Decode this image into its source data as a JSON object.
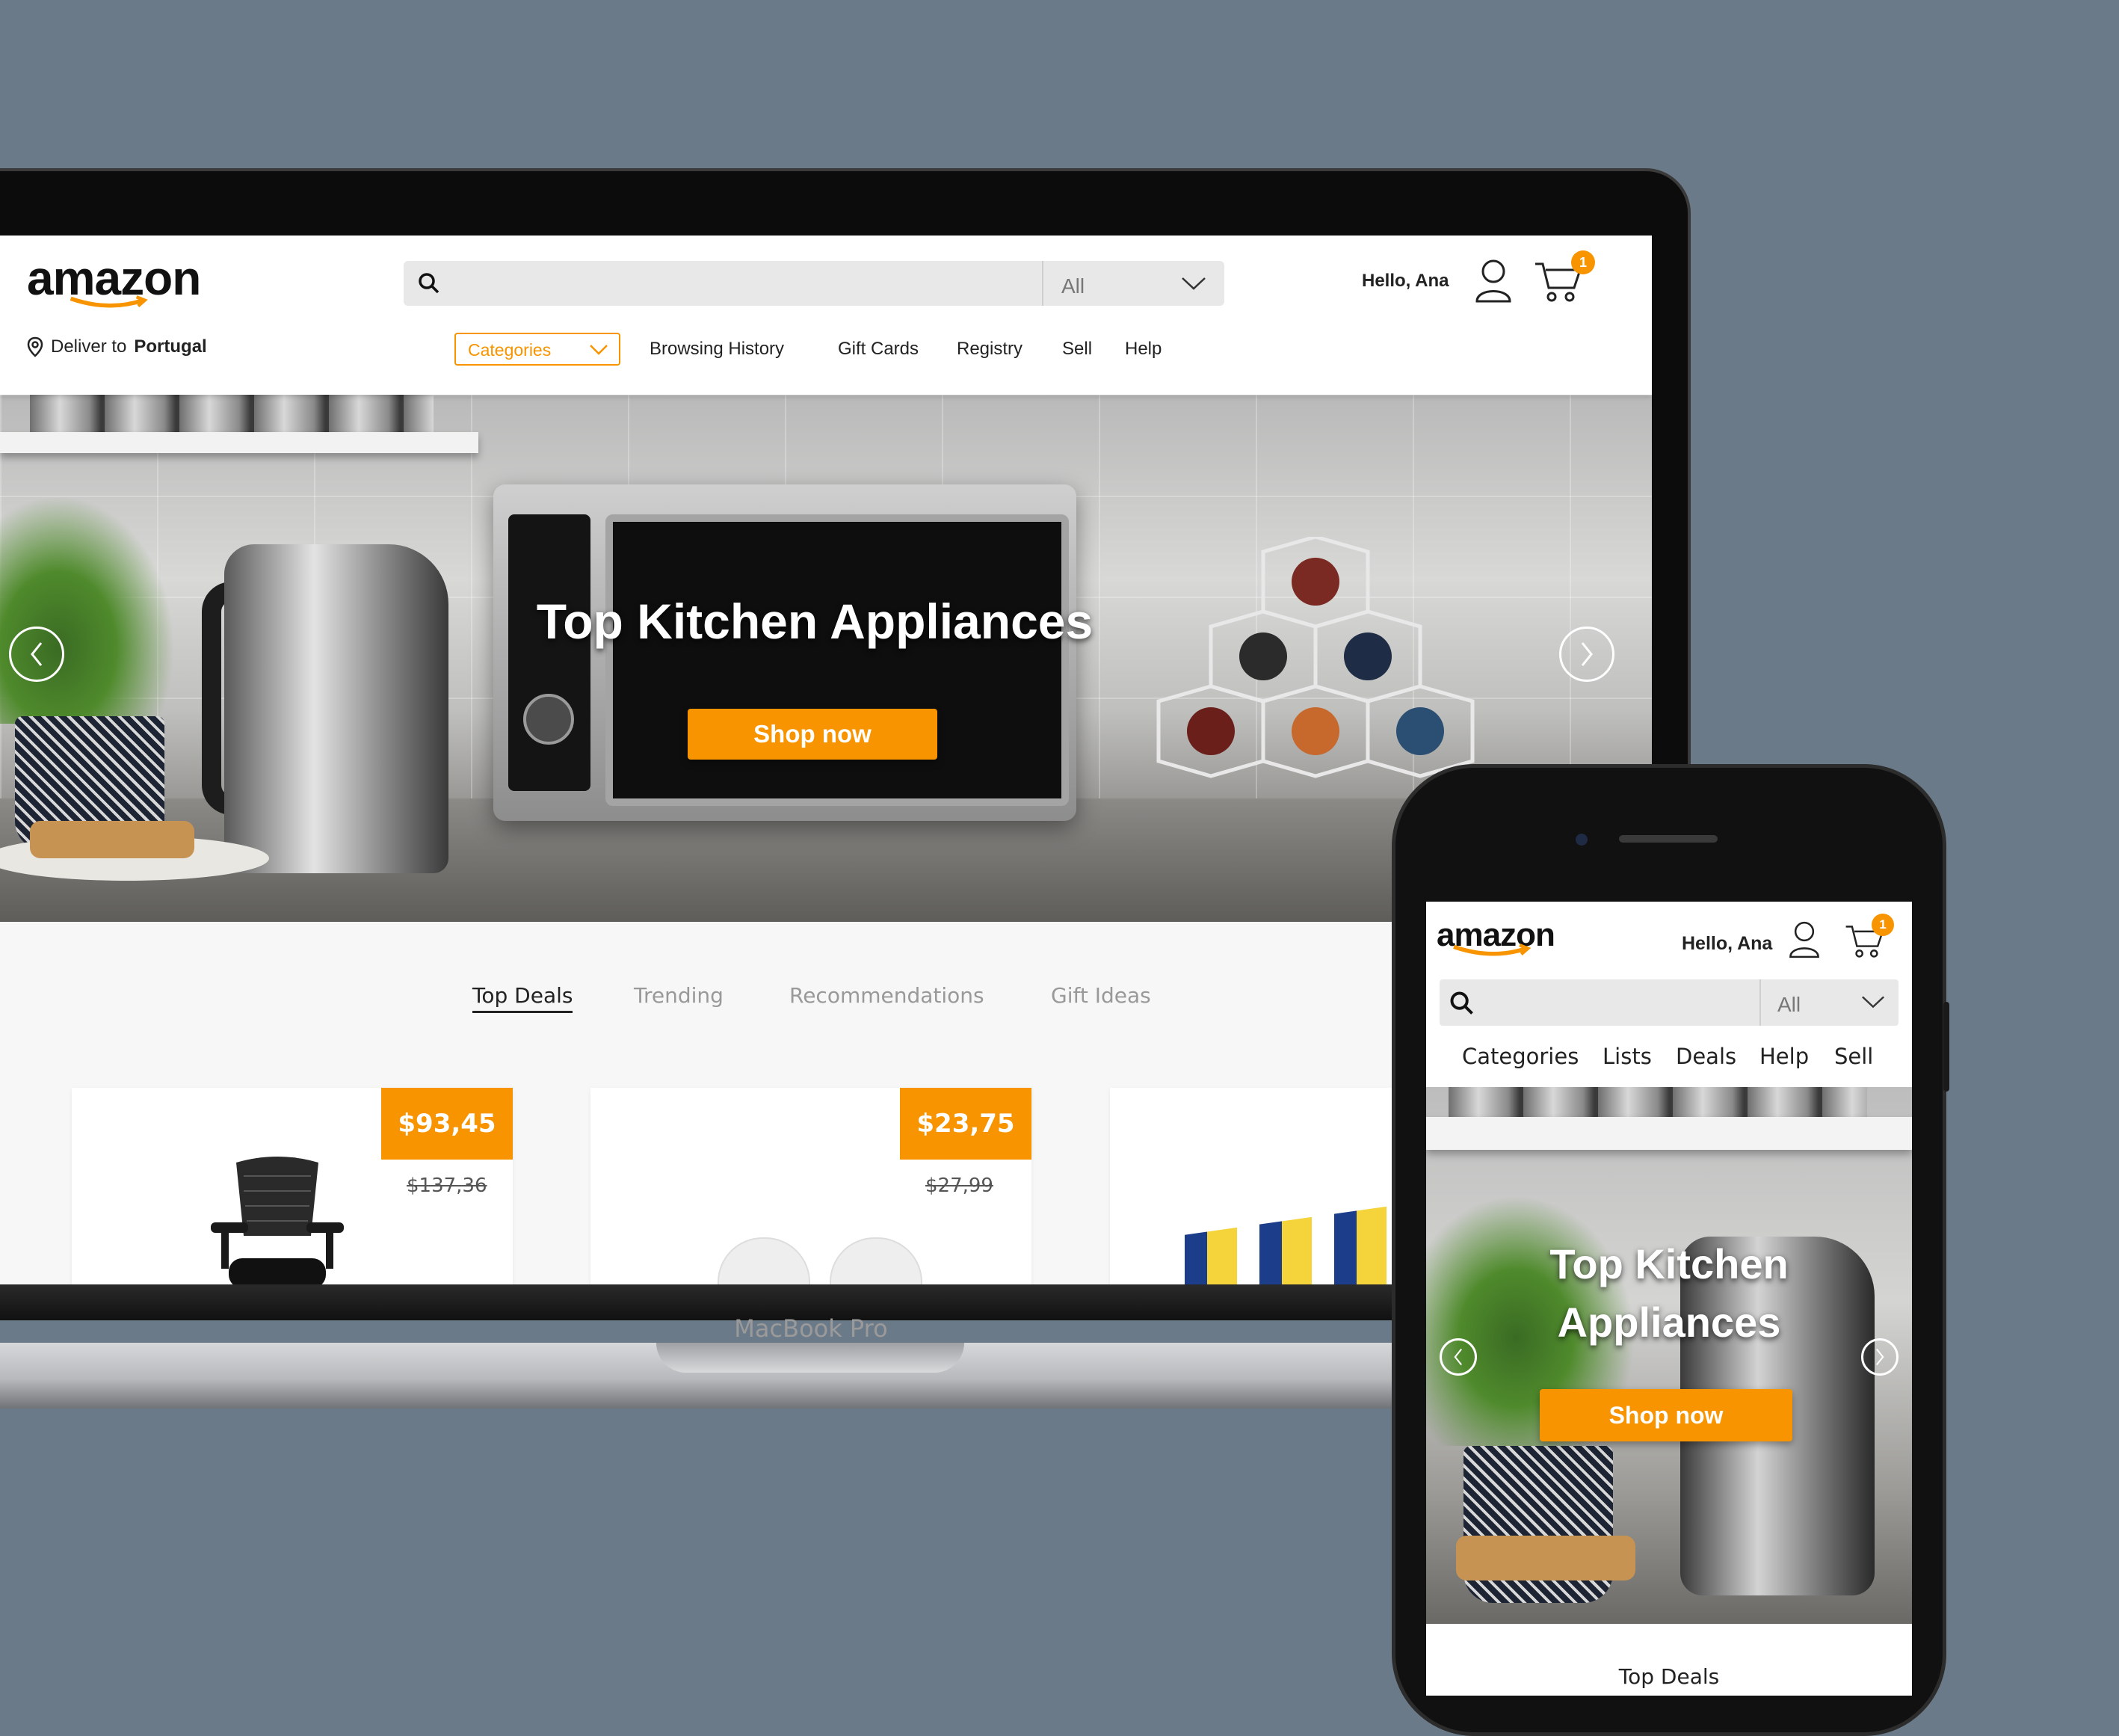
{
  "brand": {
    "logo_text": "amazon",
    "accent_color": "#f79400",
    "device_label": "MacBook Pro"
  },
  "desktop": {
    "deliver": {
      "prefix": "Deliver to",
      "location": "Portugal",
      "icon": "location-pin-icon"
    },
    "search": {
      "value": "",
      "scope": "All"
    },
    "greeting": "Hello, Ana",
    "cart_count": "1",
    "categories_label": "Categories",
    "nav": [
      "Browsing History",
      "Gift Cards",
      "Registry",
      "Sell",
      "Help"
    ],
    "hero": {
      "title": "Top Kitchen Appliances",
      "cta": "Shop now"
    },
    "tabs": [
      "Top Deals",
      "Trending",
      "Recommendations",
      "Gift Ideas"
    ],
    "active_tab": "Top Deals",
    "products": [
      {
        "price": "$93,45",
        "old_price": "$137,36"
      },
      {
        "price": "$23,75",
        "old_price": "$27,99"
      },
      {
        "price": "",
        "old_price": ""
      }
    ]
  },
  "mobile": {
    "greeting": "Hello, Ana",
    "cart_count": "1",
    "search": {
      "value": "",
      "scope": "All"
    },
    "nav": [
      "Categories",
      "Lists",
      "Deals",
      "Help",
      "Sell"
    ],
    "hero": {
      "title_line1": "Top Kitchen",
      "title_line2": "Appliances",
      "cta": "Shop now"
    },
    "section_title": "Top Deals"
  }
}
